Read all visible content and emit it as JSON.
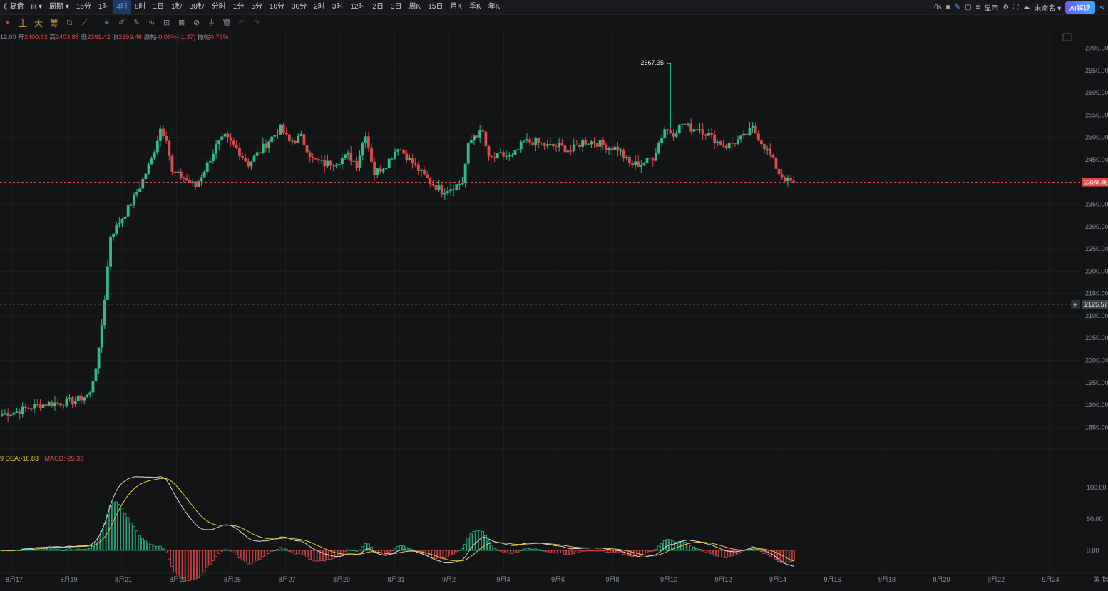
{
  "topbar": {
    "replay_label": "复盘",
    "period_label": "周期",
    "intervals": [
      "15分",
      "1时",
      "4时",
      "8时",
      "1日",
      "1秒",
      "30秒",
      "分时",
      "1分",
      "5分",
      "10分",
      "30分",
      "2时",
      "3时",
      "12时",
      "2日",
      "3日",
      "周K",
      "15日",
      "月K",
      "季K",
      "年K"
    ],
    "active_interval": "4时",
    "right": {
      "latency": "0s",
      "display_label": "显示",
      "unnamed_label": "未命名",
      "ai_label": "AI解读"
    }
  },
  "toolbar": {
    "main_label": "主",
    "big_label": "大",
    "chips_label": "筹"
  },
  "ohlc": {
    "time": "12:00",
    "open_label": "开",
    "open": "2400.83",
    "high_label": "高",
    "high": "2408.88",
    "low_label": "低",
    "low": "2391.42",
    "close_label": "收",
    "close": "2399.46",
    "change_label": "涨幅",
    "change": "-0.06%(-1.37)",
    "amp_label": "振幅",
    "amp": "0.73%"
  },
  "macd": {
    "prefix": "9",
    "dea_label": "DEA:-10.83",
    "macd_label": "MACD:-25.33"
  },
  "colors": {
    "up": "#2ebd85",
    "down": "#e0494a",
    "price_line": "#e0494a",
    "dif_line": "#d8d8d8",
    "dea_line": "#e6c84a",
    "bg": "#131416"
  },
  "chart_data": {
    "type": "candlestick",
    "y_ticks": [
      "2700.00",
      "2650.00",
      "2600.00",
      "2550.00",
      "2500.00",
      "2450.00",
      "2400.00",
      "2350.00",
      "2300.00",
      "2250.00",
      "2200.00",
      "2150.00",
      "2100.00",
      "2050.00",
      "2000.00",
      "1950.00",
      "1900.00",
      "1850.00"
    ],
    "ylim": [
      1825,
      2720
    ],
    "last_price": "2399.46",
    "crosshair_price": "2125.57",
    "high_marker": "2667.35",
    "macd_ticks": [
      "100.00",
      "50.00",
      "0.00"
    ],
    "x_labels": [
      "8月17",
      "8月19",
      "8月21",
      "8月23",
      "8月25",
      "8月27",
      "8月29",
      "8月31",
      "9月2",
      "9月4",
      "9月6",
      "9月8",
      "9月10",
      "9月12",
      "9月14",
      "9月16",
      "9月18",
      "9月20",
      "9月22",
      "9月24"
    ],
    "right_edge_label": "筹",
    "right_edge_label2": "指",
    "anchors": [
      [
        0,
        1880
      ],
      [
        5,
        1885
      ],
      [
        10,
        1895
      ],
      [
        15,
        1903
      ],
      [
        20,
        1905
      ],
      [
        25,
        1910
      ],
      [
        30,
        1925
      ],
      [
        33,
        2020
      ],
      [
        35,
        2140
      ],
      [
        37,
        2280
      ],
      [
        40,
        2310
      ],
      [
        43,
        2340
      ],
      [
        47,
        2390
      ],
      [
        51,
        2450
      ],
      [
        54,
        2520
      ],
      [
        56,
        2500
      ],
      [
        58,
        2420
      ],
      [
        62,
        2410
      ],
      [
        66,
        2390
      ],
      [
        70,
        2440
      ],
      [
        73,
        2480
      ],
      [
        76,
        2500
      ],
      [
        80,
        2475
      ],
      [
        84,
        2440
      ],
      [
        88,
        2470
      ],
      [
        92,
        2500
      ],
      [
        95,
        2520
      ],
      [
        98,
        2490
      ],
      [
        102,
        2500
      ],
      [
        106,
        2450
      ],
      [
        110,
        2440
      ],
      [
        114,
        2445
      ],
      [
        118,
        2460
      ],
      [
        121,
        2440
      ],
      [
        124,
        2510
      ],
      [
        127,
        2420
      ],
      [
        131,
        2440
      ],
      [
        135,
        2480
      ],
      [
        139,
        2450
      ],
      [
        143,
        2420
      ],
      [
        146,
        2400
      ],
      [
        150,
        2380
      ],
      [
        154,
        2390
      ],
      [
        157,
        2400
      ],
      [
        159,
        2480
      ],
      [
        161,
        2505
      ],
      [
        164,
        2510
      ],
      [
        166,
        2450
      ],
      [
        170,
        2460
      ],
      [
        174,
        2455
      ],
      [
        178,
        2490
      ],
      [
        182,
        2490
      ],
      [
        186,
        2480
      ],
      [
        190,
        2480
      ],
      [
        194,
        2470
      ],
      [
        198,
        2490
      ],
      [
        202,
        2490
      ],
      [
        206,
        2480
      ],
      [
        210,
        2475
      ],
      [
        214,
        2440
      ],
      [
        218,
        2440
      ],
      [
        222,
        2455
      ],
      [
        226,
        2520
      ],
      [
        229,
        2510
      ],
      [
        232,
        2530
      ],
      [
        235,
        2520
      ],
      [
        238,
        2520
      ],
      [
        241,
        2505
      ],
      [
        244,
        2490
      ],
      [
        247,
        2480
      ],
      [
        250,
        2490
      ],
      [
        253,
        2500
      ],
      [
        256,
        2520
      ],
      [
        259,
        2490
      ],
      [
        262,
        2460
      ],
      [
        265,
        2420
      ],
      [
        268,
        2402
      ],
      [
        270,
        2399
      ]
    ],
    "last_bar_index": 270,
    "future_bars": 95
  }
}
